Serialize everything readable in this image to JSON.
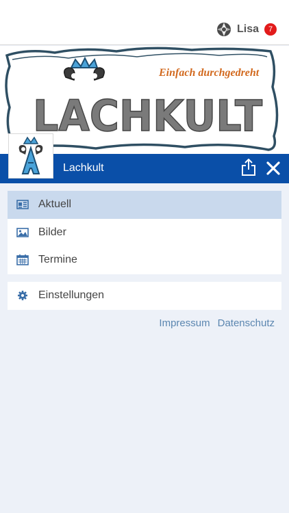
{
  "user": {
    "name": "Lisa",
    "notifications": "7"
  },
  "banner": {
    "title": "LACHKULT",
    "slogan": "Einfach durchgedreht"
  },
  "header": {
    "title": "Lachkult"
  },
  "menu": {
    "items": [
      {
        "label": "Aktuell",
        "icon": "newspaper-icon",
        "active": true
      },
      {
        "label": "Bilder",
        "icon": "image-icon"
      },
      {
        "label": "Termine",
        "icon": "calendar-icon"
      }
    ],
    "settings": {
      "label": "Einstellungen",
      "icon": "gear-icon"
    }
  },
  "footer": {
    "impressum": "Impressum",
    "datenschutz": "Datenschutz"
  },
  "colors": {
    "primary": "#0a4fa8",
    "active": "#c9d9ed",
    "background": "#edf1f8",
    "link": "#5b86b0",
    "badge": "#e21b1b"
  }
}
